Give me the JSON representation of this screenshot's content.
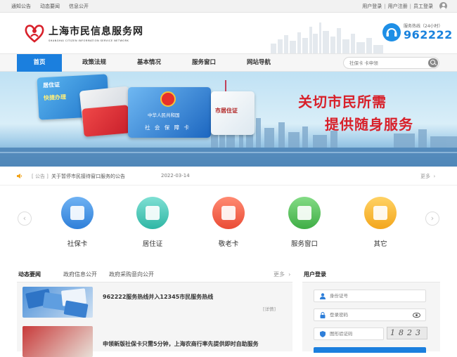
{
  "topbar": {
    "left_links": [
      "通知公告",
      "动态要闻",
      "信息公开"
    ],
    "right_links": [
      "用户登录",
      "用户注册",
      "员工登录"
    ],
    "separator": "|"
  },
  "header": {
    "site_name": "上海市民信息服务网",
    "site_name_en": "SHANGHAI CITIZEN INFORMATION SERVICE NETWORK",
    "hotline_label": "服务热线（24小时）",
    "hotline_number": "962222"
  },
  "nav": {
    "items": [
      "首页",
      "政策法规",
      "基本情况",
      "服务窗口",
      "网站导航"
    ],
    "active_index": 0,
    "search_placeholder": "社保卡 卡申领"
  },
  "banner": {
    "slogan_line1": "关切市民所需",
    "slogan_line2": "提供随身服务",
    "card_labels": [
      "居住证",
      "快捷办理",
      "中华人民共和国",
      "社 会 保 障 卡",
      "市居住证",
      "敬老卡"
    ]
  },
  "notice": {
    "tag": "[ 公告 ]",
    "text": "关于暂停市民接待窗口服务的公告",
    "date": "2022-03-14",
    "more": "更多"
  },
  "services": [
    {
      "label": "社保卡",
      "color": "#3f8ee0"
    },
    {
      "label": "居住证",
      "color": "#3dc4b4"
    },
    {
      "label": "敬老卡",
      "color": "#f2664e"
    },
    {
      "label": "服务窗口",
      "color": "#56c25a"
    },
    {
      "label": "其它",
      "color": "#f5b731"
    }
  ],
  "news": {
    "tabs": [
      "动态要闻",
      "政府信息公开",
      "政府采购意向公开"
    ],
    "active_tab": 0,
    "more": "更多",
    "items": [
      {
        "title": "962222服务热线并入12345市民服务热线",
        "detail": "[详情]"
      },
      {
        "title": "申领新版社保卡只需5分钟，上海农商行率先提供即时自助服务",
        "detail": ""
      }
    ]
  },
  "login": {
    "title": "用户登录",
    "id_placeholder": "身份证号",
    "password_placeholder": "登录密码",
    "captcha_placeholder": "图形验证码",
    "captcha_text": "1823"
  },
  "colors": {
    "primary": "#1b7fde",
    "slogan": "#d8202a"
  }
}
